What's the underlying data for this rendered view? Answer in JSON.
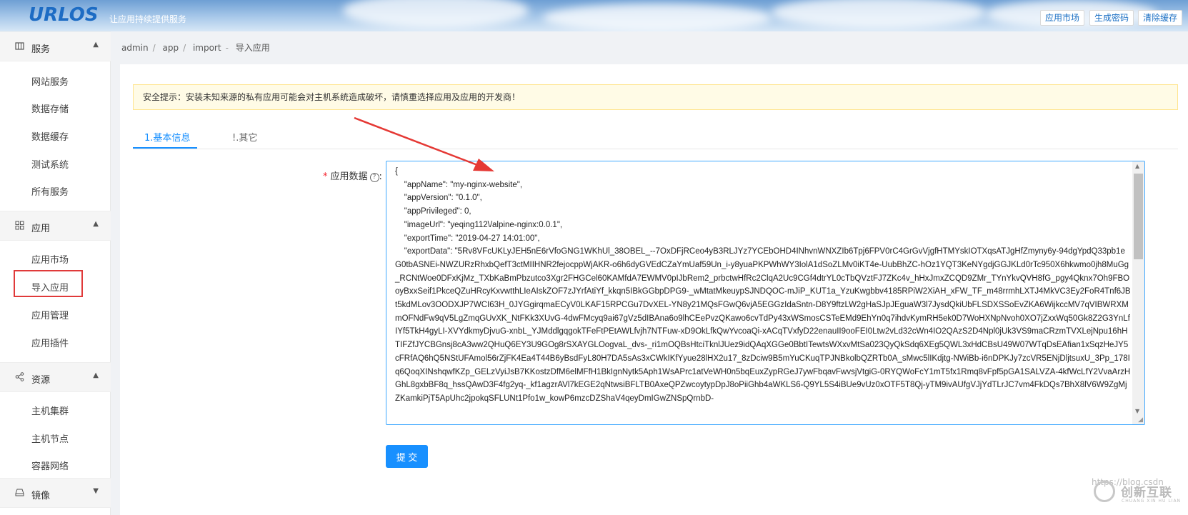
{
  "header": {
    "logo": "URLOS",
    "slogan": "让应用持续提供服务",
    "buttons": [
      "应用市场",
      "生成密码",
      "清除缓存"
    ]
  },
  "sidebar": {
    "groups": [
      {
        "label": "服务",
        "icon": "grid-icon",
        "items": [
          "网站服务",
          "数据存储",
          "数据缓存",
          "测试系统",
          "所有服务"
        ]
      },
      {
        "label": "应用",
        "icon": "apps-icon",
        "items": [
          "应用市场",
          "导入应用",
          "应用管理",
          "应用插件"
        ]
      },
      {
        "label": "资源",
        "icon": "share-icon",
        "items": [
          "主机集群",
          "主机节点",
          "容器网络"
        ]
      },
      {
        "label": "镜像",
        "icon": "hdd-icon",
        "items": []
      }
    ]
  },
  "breadcrumb": [
    "admin",
    "app",
    "import",
    "导入应用"
  ],
  "warning": "安全提示：安装未知来源的私有应用可能会对主机系统造成破坏，请慎重选择应用及应用的开发商！",
  "tabs": [
    "1.基本信息",
    "!.其它"
  ],
  "form": {
    "label": "应用数据",
    "textarea_value": "{\n    \"appName\": \"my-nginx-website\",\n    \"appVersion\": \"0.1.0\",\n    \"appPrivileged\": 0,\n    \"imageUrl\": \"yeqing112\\/alpine-nginx:0.0.1\",\n    \"exportTime\": \"2019-04-27 14:01:00\",\n    \"exportData\": \"5Rv8VFcUKLyJEH5nE6rVfoGNG1WKhUl_38OBEL_--7OxDFjRCeo4yB3RLJYz7YCEbOHD4INhvnWNXZIb6Tpj6FPV0rC4GrGvVjgfHTMYskIOTXqsATJgHfZmyny6y-94dgYpdQ33pb1eG0tbASNEi-NWZURzRhxbQefT3ctMIIHNR2fejocppWjAKR-o6h6dyGVEdCZaYmUaf59Un_i-y8yuaPKPWhWY3IolA1dSoZLMv0iKT4e-UubBhZC-hOz1YQT3KeNYgdjGGJKLd0rTc950X6hkwmo0jh8MuGg_RCNtWoe0DFxKjMz_TXbKaBmPbzutco3Xgr2FHGCel60KAMfdA7EWMV0pIJbRem2_prbctwHfRc2ClqA2Uc9CGf4dtrYL0cTbQVztFJ7ZKc4v_hHxJmxZCQD9ZMr_TYnYkvQVH8fG_pgy4Qknx7Oh9FBOoyBxxSeif1PkceQZuHRcyKxvwtthLIeAIskZOF7zJYrfAtiYf_kkqn5IBkGGbpDPG9-_wMtatMkeuypSJNDQOC-mJiP_KUT1a_YzuKwgbbv4185RPiW2XiAH_xFW_TF_m48rrmhLXTJ4MkVC3Ey2FoR4Tnf6JBt5kdMLov3OODXJP7WCI63H_0JYGgirqmaECyV0LKAF15RPCGu7DvXEL-YN8y21MQsFGwQ6vjA5EGGzIdaSntn-D8Y9ftzLW2gHaSJpJEguaW3l7JysdQkiUbFLSDXSSoEvZKA6WijkccMV7qVIBWRXMmOFNdFw9qV5LgZmqGUvXK_NtFKk3XUvG-4dwFMcyq9ai67gVz5dIBAna6o9lhCEePvzQKawo6cvTdPy43xWSmosCSTeEMd9EhYn0q7ihdvKymRH5ek0D7WoHXNpNvoh0XO7jZxxWq50Gk8Z2G3YnLfIYf5TkH4gyLI-XVYdkmyDjvuG-xnbL_YJMddlgqgokTFeFtPEtAWLfvjh7NTFuw-xD9OkLfkQwYvcoaQi-xACqTVxfyD22enauII9ooFEI0Ltw2vLd32cWn4IO2QAzS2D4Npl0jUk3VS9maCRzmTVXLejNpu16hHTIFZfJYCBGnsj8cA3ww2QHuQ6EY3U9GOg8rSXAYGLOogvaL_dvs-_ri1mOQBsHtciTknlJUez9idQAqXGGe0BbtITewtsWXxvMtSa023QyQkSdq6XEg5QWL3xHdCBsU49W07WTqDsEAfian1xSqzHeJY5cFRfAQ6hQ5NStUFAmol56rZjFK4Ea4T44B6yBsdFyL80H7DA5sAs3xCWkIKfYyue28lHX2u17_8zDciw9B5mYuCKuqTPJNBkolbQZRTb0A_sMwc5lIKdjtg-NWiBb-i6nDPKJy7zcVR5ENjDljtsuxU_3Pp_178Iq6QoqXINshqwfKZp_GELzVyiJsB7KKostzDfM6elMFfH1BkIgnNytk5Aph1WsAPrc1atVeWH0n5bqEuxZypRGeJ7ywFbqavFwvsjVtgiG-0RYQWoFcY1mT5fx1Rmq8vFpf5pGA1SALVZA-4kfWcLfY2VvaArzHGhL8gxbBF8q_hssQAwD3F4fg2yq-_kf1agzrAVl7kEGE2qNtwsiBFLTB0AxeQPZwcoytypDpJ8oPiiGhb4aWKLS6-Q9YL5S4iBUe9vUz0xOTF5T8Qj-yTM9ivAUfgVJjYdTLrJC7vm4FkDQs7BhX8lV6W9ZgMjZKamkiPjT5ApUhc2jpokqSFLUNt1Pfo1w_kowP6mzcDZShaV4qeyDmIGwZNSpQrnbD-"
  },
  "submit_label": "提 交",
  "watermark": "https://blog.csdn",
  "brand": {
    "name": "创新互联",
    "sub": "CHUANG XIN HU LIAN"
  }
}
